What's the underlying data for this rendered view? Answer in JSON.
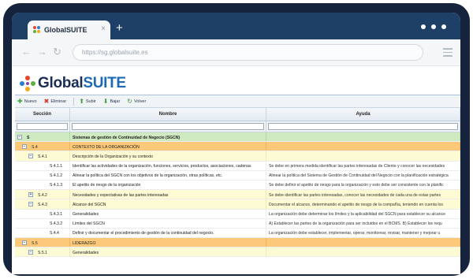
{
  "browser": {
    "tab_title": "GlobalSUITE",
    "tab_close": "×",
    "new_tab": "+",
    "url": "https://sg.globalsuite.es",
    "back": "←",
    "forward": "→",
    "reload": "↻"
  },
  "brand": {
    "prefix": "Global",
    "suffix": "SUITE"
  },
  "toolbar": {
    "new_label": "Nuevo",
    "delete_label": "Eliminar",
    "up_label": "Subir",
    "down_label": "Bajar",
    "back_label": "Volver"
  },
  "columns": {
    "section": "Sección",
    "name": "Nombre",
    "help": "Ayuda"
  },
  "filters": {
    "section": "",
    "name": "",
    "help": ""
  },
  "rows": [
    {
      "level": 0,
      "toggle": "−",
      "section": "S",
      "name": "Sistemas de gestión de Continuidad de Negocio (SGCN)",
      "help": ""
    },
    {
      "level": 1,
      "toggle": "−",
      "section": "S.4",
      "name": "CONTEXTO DE LA ORGANIZACIÓN",
      "help": ""
    },
    {
      "level": 2,
      "toggle": "−",
      "section": "S.4.1",
      "name": "Descripción de la Organización y su contexto",
      "help": ""
    },
    {
      "level": 3,
      "toggle": "",
      "section": "S.4.1.1",
      "name": "Identificar las actividades de la organización, funciones, servicios, productos, asociaciones, cadenas",
      "help": "Se debe en primera medida identificar las partes interesadas de Cliente y conocer las necesidades"
    },
    {
      "level": 3,
      "toggle": "",
      "section": "S.4.1.2",
      "name": "Alinear la política del SGCN con los objetivos de la organización, otras políticas, etc.",
      "help": "Alinear la política del Sistema de Gestión de Continuidad del Negocio con la planificación estratégica"
    },
    {
      "level": 3,
      "toggle": "",
      "section": "S.4.1.3",
      "name": "El apetito de riesgo de la organización",
      "help": "Se debe definir el apetito de riesgo para la organización y esto debe ser consistente con la planific"
    },
    {
      "level": 2,
      "toggle": "+",
      "section": "S.4.2",
      "name": "Necesidades y expectativas de las partes interesadas",
      "help": "Se debe identificar las partes interesadas, conocer las necesidades de cada una de estas partes"
    },
    {
      "level": 2,
      "toggle": "−",
      "section": "S.4.3",
      "name": "Alcance del SGCN",
      "help": "Documentar el alcance, determinando el apetito de riesgo de la compañía, teniendo en cuenta los"
    },
    {
      "level": 3,
      "toggle": "",
      "section": "S.4.3.1",
      "name": "Generalidades",
      "help": "La organización debe determinar los límites y la aplicabilidad del SGCN para establecer su alcance"
    },
    {
      "level": 3,
      "toggle": "",
      "section": "S.4.3.2",
      "name": "Límites del SGCN",
      "help": "A) Establecer las partes de la organización para ser incluidos en el BCMS. B) Establecer los requ"
    },
    {
      "level": 3,
      "toggle": "",
      "section": "S.4.4",
      "name": "Definir y documentar el procedimiento de gestión de la continuidad del negocio.",
      "help": "La organización debe establecer, implementar, operar, monitorear, revisar, mantener y mejorar u"
    },
    {
      "level": 1,
      "toggle": "−",
      "section": "S.5",
      "name": "LIDERAZGO",
      "help": ""
    },
    {
      "level": 2,
      "toggle": "−",
      "section": "S.5.1",
      "name": "Generalidades",
      "help": ""
    }
  ],
  "colors": {
    "level0": "#cfe9c0",
    "level1": "#fcc87a",
    "level2": "#fdfbd4",
    "level3": "#ffffff",
    "frame": "#15233c",
    "tabbar": "#1e3f66"
  }
}
